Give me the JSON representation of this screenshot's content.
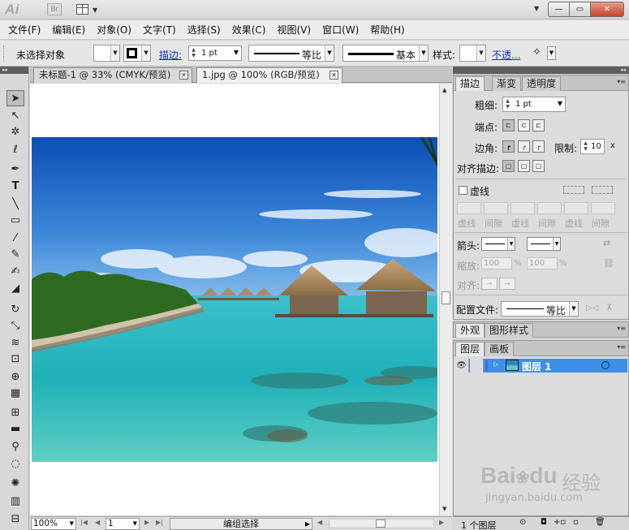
{
  "titlebar": {
    "app_logo": "Ai",
    "bridge": "Br",
    "window_buttons": {
      "minimize": "—",
      "restore": "▭",
      "close": "✕"
    }
  },
  "menu": [
    "文件(F)",
    "编辑(E)",
    "对象(O)",
    "文字(T)",
    "选择(S)",
    "效果(C)",
    "视图(V)",
    "窗口(W)",
    "帮助(H)"
  ],
  "control_bar": {
    "selection_status": "未选择对象",
    "stroke_label": "描边:",
    "stroke_weight": "1 pt",
    "profile_label": "等比",
    "brush_label": "基本",
    "style_label": "样式:",
    "opacity_label": "不透..."
  },
  "doc_tabs": [
    {
      "label": "未标题-1 @ 33% (CMYK/预览)",
      "active": false
    },
    {
      "label": "1.jpg @ 100% (RGB/预览)",
      "active": true
    }
  ],
  "status_bar": {
    "zoom": "100%",
    "artboard": "1",
    "tool_status": "编组选择"
  },
  "stroke_panel": {
    "tabs": [
      "描边",
      "渐变",
      "透明度"
    ],
    "weight_label": "粗细:",
    "weight_value": "1 pt",
    "cap_label": "端点:",
    "corner_label": "边角:",
    "limit_label": "限制:",
    "limit_value": "10",
    "limit_unit": "x",
    "align_label": "对齐描边:",
    "dashed_label": "虚线",
    "dash_labels": [
      "虚线",
      "间隙",
      "虚线",
      "间隙",
      "虚线",
      "间隙"
    ],
    "arrow_label": "箭头:",
    "scale_label": "缩放:",
    "scale_value_1": "100",
    "scale_value_2": "100",
    "percent": "%",
    "align_arrow_label": "对齐:",
    "profile_label": "配置文件:",
    "profile_value": "等比"
  },
  "appearance_panel": {
    "tabs": [
      "外观",
      "图形样式"
    ]
  },
  "layers_panel": {
    "tabs": [
      "图层",
      "画板"
    ],
    "layers": [
      {
        "name": "图层 1"
      }
    ],
    "footer_count": "1 个图层"
  },
  "watermark": {
    "logo": "Bai",
    "paw": "du",
    "cn": "经验",
    "url": "jingyan.baidu.com"
  },
  "colors": {
    "layer_highlight": "#3d8fe8",
    "close_button": "#c7462b"
  }
}
